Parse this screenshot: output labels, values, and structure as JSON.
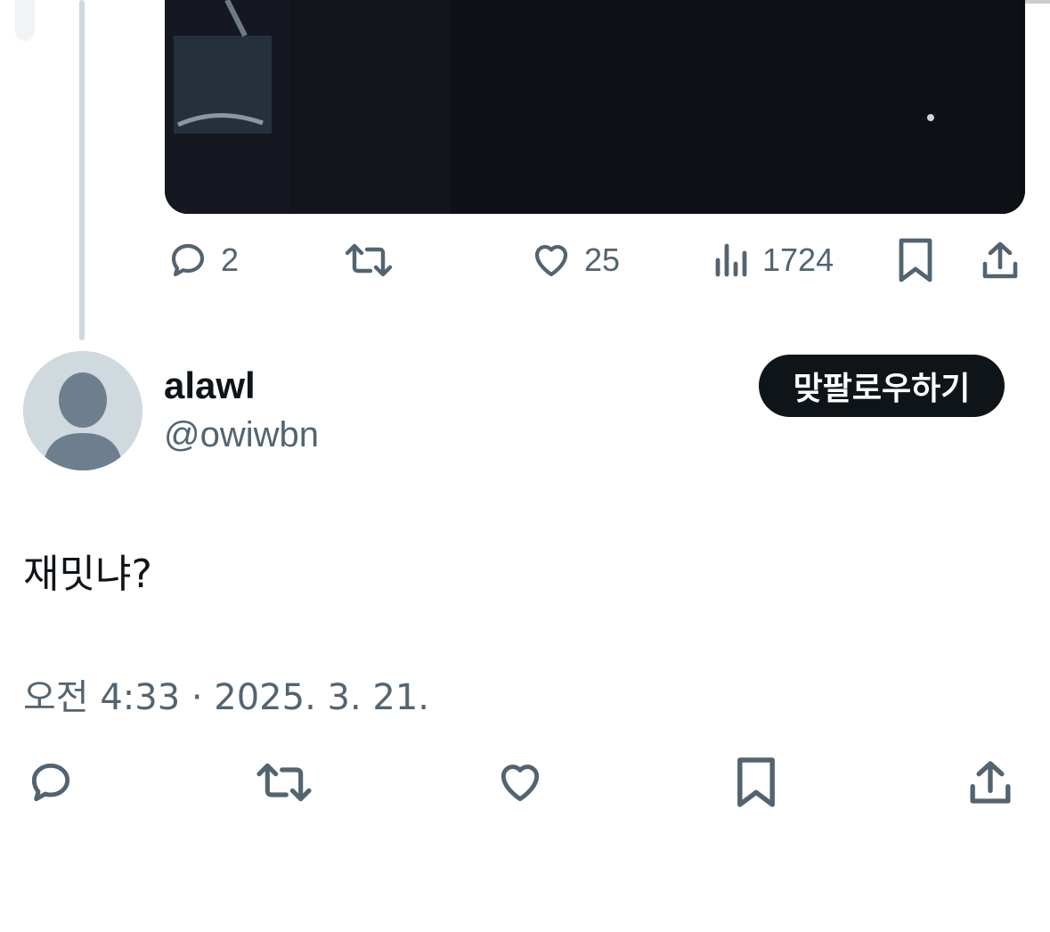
{
  "parent_tweet": {
    "actions": {
      "reply_count": "2",
      "like_count": "25",
      "view_count": "1724"
    }
  },
  "reply_tweet": {
    "display_name": "alawl",
    "handle": "@owiwbn",
    "follow_label": "맞팔로우하기",
    "text": "재밋냐?",
    "timestamp": "오전 4:33 · 2025. 3. 21."
  },
  "icons": [
    "reply-icon",
    "retweet-icon",
    "like-icon",
    "views-icon",
    "bookmark-icon",
    "share-icon"
  ],
  "colors": {
    "icon_gray": "#536471",
    "thread_line": "#cfd9de",
    "follow_button": "#0f1419"
  }
}
